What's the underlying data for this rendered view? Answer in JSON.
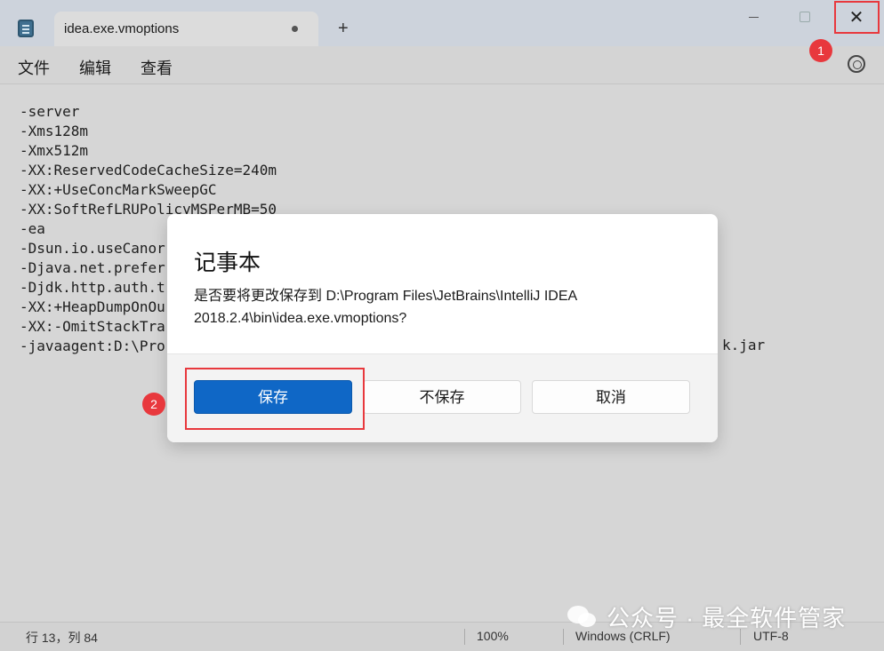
{
  "tab": {
    "title": "idea.exe.vmoptions",
    "new_tab": "+"
  },
  "window": {
    "close_glyph": "✕"
  },
  "menu": {
    "file": "文件",
    "edit": "编辑",
    "view": "查看"
  },
  "editor": {
    "lines": [
      "-server",
      "-Xms128m",
      "-Xmx512m",
      "-XX:ReservedCodeCacheSize=240m",
      "-XX:+UseConcMarkSweepGC",
      "-XX:SoftRefLRUPolicyMSPerMB=50",
      "-ea",
      "-Dsun.io.useCanor",
      "-Djava.net.prefer",
      "-Djdk.http.auth.t",
      "-XX:+HeapDumpOnOu",
      "-XX:-OmitStackTra",
      "-javaagent:D:\\Pro"
    ],
    "line_tail": "k.jar"
  },
  "dialog": {
    "title": "记事本",
    "message": "是否要将更改保存到 D:\\Program Files\\JetBrains\\IntelliJ IDEA 2018.2.4\\bin\\idea.exe.vmoptions?",
    "save": "保存",
    "dont_save": "不保存",
    "cancel": "取消"
  },
  "annotations": {
    "badge_1": "1",
    "badge_2": "2"
  },
  "status": {
    "position": "行 13，列 84",
    "zoom": "100%",
    "line_ending": "Windows (CRLF)",
    "encoding": "UTF-8"
  },
  "watermark": {
    "text": "公众号 · 最全软件管家"
  },
  "colors": {
    "accent": "#0f67c6",
    "annotation_red": "#e8383d"
  },
  "icons": {
    "app": "notepad-icon",
    "settings": "gear-icon",
    "close": "close-icon"
  }
}
